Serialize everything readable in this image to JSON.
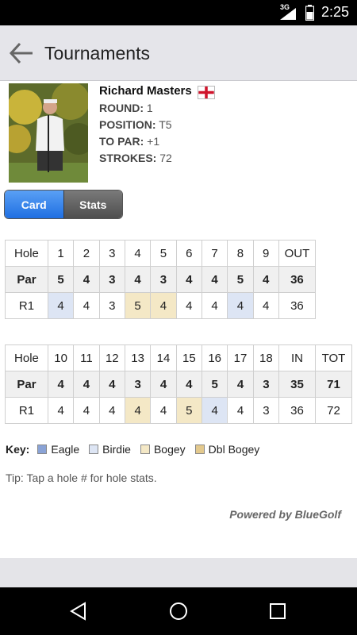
{
  "status": {
    "network": "3G",
    "time": "2:25"
  },
  "appbar": {
    "title": "Tournaments"
  },
  "player": {
    "name": "Richard Masters",
    "round_label": "ROUND:",
    "round": "1",
    "position_label": "POSITION:",
    "position": "T5",
    "topar_label": "TO PAR:",
    "topar": "+1",
    "strokes_label": "STROKES:",
    "strokes": "72"
  },
  "tabs": {
    "card": "Card",
    "stats": "Stats"
  },
  "front": {
    "header": [
      "Hole",
      "1",
      "2",
      "3",
      "4",
      "5",
      "6",
      "7",
      "8",
      "9",
      "OUT"
    ],
    "par": [
      "Par",
      "5",
      "4",
      "3",
      "4",
      "3",
      "4",
      "4",
      "5",
      "4",
      "36"
    ],
    "r1": [
      "R1",
      "4",
      "4",
      "3",
      "5",
      "4",
      "4",
      "4",
      "4",
      "4",
      "36"
    ]
  },
  "back": {
    "header": [
      "Hole",
      "10",
      "11",
      "12",
      "13",
      "14",
      "15",
      "16",
      "17",
      "18",
      "IN",
      "TOT"
    ],
    "par": [
      "Par",
      "4",
      "4",
      "4",
      "3",
      "4",
      "4",
      "5",
      "4",
      "3",
      "35",
      "71"
    ],
    "r1": [
      "R1",
      "4",
      "4",
      "4",
      "4",
      "4",
      "5",
      "4",
      "4",
      "3",
      "36",
      "72"
    ]
  },
  "key": {
    "label": "Key:",
    "eagle": "Eagle",
    "birdie": "Birdie",
    "bogey": "Bogey",
    "dbl": "Dbl Bogey"
  },
  "colors": {
    "eagle": "#8aa3d6",
    "birdie": "#dde5f4",
    "bogey": "#f4e8c6",
    "dbl_bogey": "#e3c98d",
    "accent": "#1f6fe2"
  },
  "tip": "Tip: Tap a hole # for hole stats.",
  "powered": "Powered by BlueGolf"
}
